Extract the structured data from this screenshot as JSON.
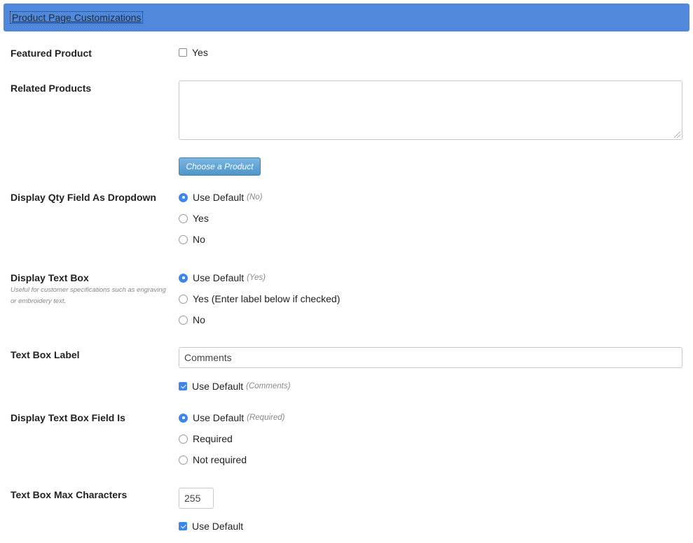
{
  "header": {
    "title": "Product Page Customizations",
    "bg_color": "#5089db"
  },
  "featured": {
    "label": "Featured Product",
    "checkbox_label": "Yes",
    "checked": false
  },
  "related": {
    "label": "Related Products",
    "textarea_value": "",
    "button_label": "Choose a Product"
  },
  "qty_dropdown": {
    "label": "Display Qty Field As Dropdown",
    "options": [
      {
        "label": "Use Default",
        "default_hint": "(No)",
        "selected": true
      },
      {
        "label": "Yes",
        "selected": false
      },
      {
        "label": "No",
        "selected": false
      }
    ]
  },
  "text_box": {
    "label": "Display Text Box",
    "hint": "Useful for customer specifications such as engraving or embroidery text.",
    "options": [
      {
        "label": "Use Default",
        "default_hint": "(Yes)",
        "selected": true
      },
      {
        "label": "Yes (Enter label below if checked)",
        "selected": false
      },
      {
        "label": "No",
        "selected": false
      }
    ]
  },
  "text_box_label": {
    "label": "Text Box Label",
    "value": "Comments",
    "use_default_label": "Use Default",
    "use_default_hint": "(Comments)",
    "use_default_checked": true
  },
  "text_box_field": {
    "label": "Display Text Box Field Is",
    "options": [
      {
        "label": "Use Default",
        "default_hint": "(Required)",
        "selected": true
      },
      {
        "label": "Required",
        "selected": false
      },
      {
        "label": "Not required",
        "selected": false
      }
    ]
  },
  "max_chars": {
    "label": "Text Box Max Characters",
    "value": "255",
    "use_default_label": "Use Default",
    "use_default_checked": true
  },
  "colors": {
    "accent": "#3d86ea",
    "button": "#5a9fd0"
  }
}
